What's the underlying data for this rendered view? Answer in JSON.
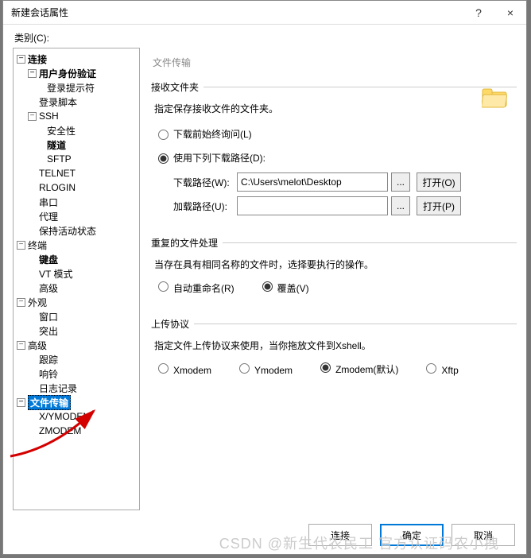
{
  "window": {
    "title": "新建会话属性",
    "help": "?",
    "close": "×"
  },
  "category_label": "类别(C):",
  "tree": {
    "connection": "连接",
    "auth": "用户身份验证",
    "login_prompt": "登录提示符",
    "login_script": "登录脚本",
    "ssh": "SSH",
    "security": "安全性",
    "tunnel": "隧道",
    "sftp": "SFTP",
    "telnet": "TELNET",
    "rlogin": "RLOGIN",
    "serial": "串口",
    "proxy": "代理",
    "keepalive": "保持活动状态",
    "terminal": "终端",
    "keyboard": "键盘",
    "vtmode": "VT 模式",
    "advanced_term": "高级",
    "appearance": "外观",
    "window": "窗口",
    "highlight": "突出",
    "advanced": "高级",
    "trace": "跟踪",
    "bell": "响铃",
    "log": "日志记录",
    "filetransfer": "文件传输",
    "xymodem": "X/YMODEM",
    "zmodem": "ZMODEM"
  },
  "panel": {
    "title": "文件传输",
    "recv_group": "接收文件夹",
    "recv_desc": "指定保存接收文件的文件夹。",
    "always_ask": "下载前始终询问(L)",
    "use_path": "使用下列下载路径(D):",
    "download_label": "下载路径(W):",
    "download_value": "C:\\Users\\melot\\Desktop",
    "upload_label": "加载路径(U):",
    "upload_value": "",
    "dots": "...",
    "open_o": "打开(O)",
    "open_p": "打开(P)",
    "dup_group": "重复的文件处理",
    "dup_desc": "当存在具有相同名称的文件时，选择要执行的操作。",
    "auto_rename": "自动重命名(R)",
    "overwrite": "覆盖(V)",
    "proto_group": "上传协议",
    "proto_desc": "指定文件上传协议来使用，当你拖放文件到Xshell。",
    "xmodem": "Xmodem",
    "ymodem": "Ymodem",
    "zmodem_default": "Zmodem(默认)",
    "xftp": "Xftp"
  },
  "footer": {
    "connect": "连接",
    "ok": "确定",
    "cancel": "取消"
  },
  "watermark": "CSDN @新生代农民工 官方认证码农小拽"
}
